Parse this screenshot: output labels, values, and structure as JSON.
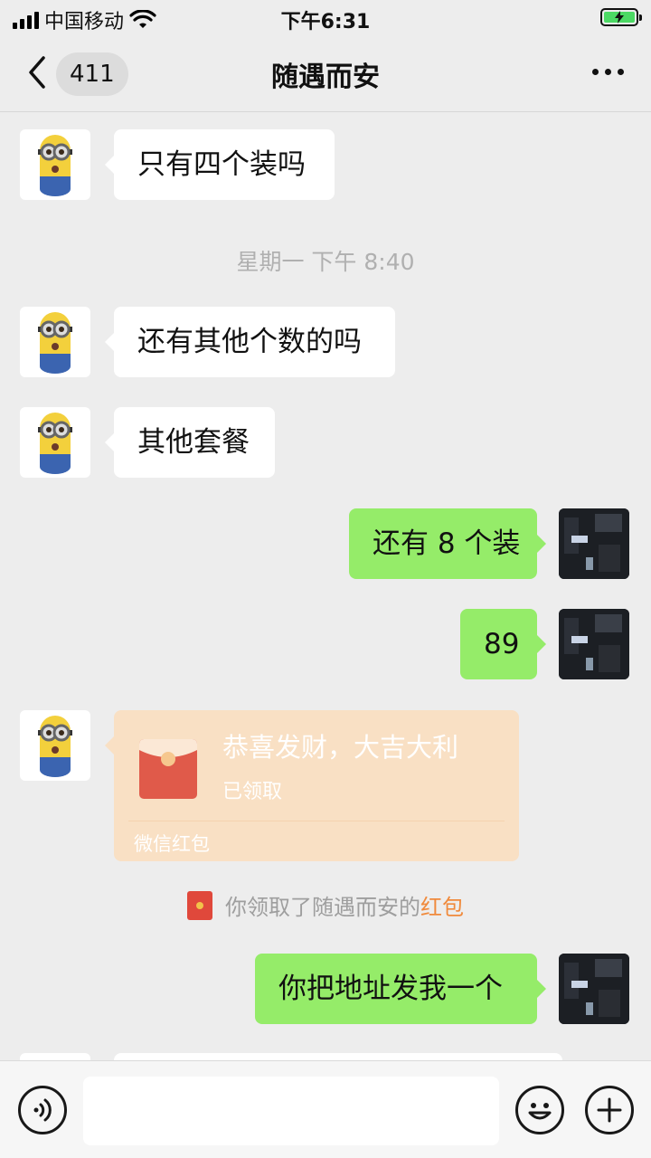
{
  "status_bar": {
    "carrier": "中国移动",
    "time": "下午6:31"
  },
  "nav": {
    "unread_count": "411",
    "title": "随遇而安"
  },
  "messages": [
    {
      "side": "in",
      "text": "只有四个装吗"
    },
    {
      "side": "in",
      "text": "还有其他个数的吗"
    },
    {
      "side": "in",
      "text": "其他套餐"
    },
    {
      "side": "out",
      "text": "还有 8 个装"
    },
    {
      "side": "out",
      "text": "89"
    },
    {
      "side": "out",
      "text": "你把地址发我一个"
    }
  ],
  "timestamp": "星期一 下午 8:40",
  "red_packet": {
    "title": "恭喜发财，大吉大利",
    "status": "已领取",
    "footer": "微信红包"
  },
  "system_notice": {
    "text": "你领取了随遇而安的",
    "link": "红包"
  },
  "icons": [
    "back-chevron-icon",
    "more-dots-icon",
    "voice-icon",
    "emoji-icon",
    "plus-icon",
    "red-packet-icon"
  ],
  "colors": {
    "outgoing_bubble": "#95ec69",
    "incoming_bubble": "#ffffff",
    "background": "#ededed",
    "red_packet_bg": "#f9e0c4",
    "link_accent": "#f08a3c"
  }
}
